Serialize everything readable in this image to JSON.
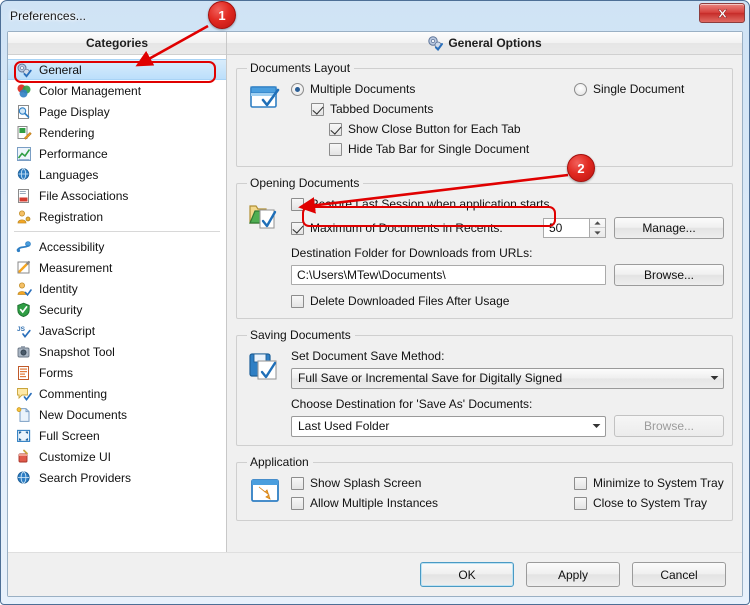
{
  "window": {
    "title": "Preferences...",
    "close_label": "Close",
    "close_icon": "window-close-icon"
  },
  "sidebar": {
    "header": "Categories",
    "selected": "General",
    "items": [
      {
        "label": "General",
        "icon": "gears-check-icon",
        "group": 1
      },
      {
        "label": "Color Management",
        "icon": "color-spheres-icon",
        "group": 1
      },
      {
        "label": "Page Display",
        "icon": "page-magnifier-icon",
        "group": 1
      },
      {
        "label": "Rendering",
        "icon": "page-pencil-icon",
        "group": 1
      },
      {
        "label": "Performance",
        "icon": "chart-graph-icon",
        "group": 1
      },
      {
        "label": "Languages",
        "icon": "globe-icon",
        "group": 1
      },
      {
        "label": "File Associations",
        "icon": "file-pdf-icon",
        "group": 1
      },
      {
        "label": "Registration",
        "icon": "user-key-icon",
        "group": 1
      },
      {
        "label": "Accessibility",
        "icon": "accessibility-icon",
        "group": 2
      },
      {
        "label": "Measurement",
        "icon": "ruler-pencil-icon",
        "group": 2
      },
      {
        "label": "Identity",
        "icon": "user-card-icon",
        "group": 2
      },
      {
        "label": "Security",
        "icon": "shield-check-icon",
        "group": 2
      },
      {
        "label": "JavaScript",
        "icon": "javascript-icon",
        "group": 2
      },
      {
        "label": "Snapshot Tool",
        "icon": "camera-icon",
        "group": 2
      },
      {
        "label": "Forms",
        "icon": "form-lines-icon",
        "group": 2
      },
      {
        "label": "Commenting",
        "icon": "comment-check-icon",
        "group": 2
      },
      {
        "label": "New Documents",
        "icon": "new-document-icon",
        "group": 2
      },
      {
        "label": "Full Screen",
        "icon": "fullscreen-icon",
        "group": 2
      },
      {
        "label": "Customize UI",
        "icon": "paint-bucket-icon",
        "group": 2
      },
      {
        "label": "Search Providers",
        "icon": "globe-search-icon",
        "group": 2
      }
    ]
  },
  "main": {
    "header": "General Options",
    "header_icon": "gears-check-icon",
    "documents_layout": {
      "legend": "Documents Layout",
      "icon": "tabbed-window-icon",
      "multiple_documents": {
        "label": "Multiple Documents",
        "checked": true
      },
      "single_document": {
        "label": "Single Document",
        "checked": false
      },
      "tabbed_documents": {
        "label": "Tabbed Documents",
        "checked": true
      },
      "show_close_button": {
        "label": "Show Close Button for Each Tab",
        "checked": true
      },
      "hide_tab_bar": {
        "label": "Hide Tab Bar for Single Document",
        "checked": false
      }
    },
    "opening_documents": {
      "legend": "Opening Documents",
      "icon": "folder-open-check-icon",
      "restore_last_session": {
        "label": "Restore Last Session when application starts",
        "checked": false
      },
      "max_recents": {
        "label": "Maximum of Documents in Recents:",
        "checked": true,
        "value": "50"
      },
      "manage_button": "Manage...",
      "destination_label": "Destination Folder for Downloads from URLs:",
      "destination_value": "C:\\Users\\MTew\\Documents\\",
      "browse_button": "Browse...",
      "delete_downloaded": {
        "label": "Delete Downloaded Files After Usage",
        "checked": false
      }
    },
    "saving_documents": {
      "legend": "Saving Documents",
      "icon": "save-disk-check-icon",
      "save_method_label": "Set Document Save Method:",
      "save_method_value": "Full Save or Incremental Save for Digitally Signed",
      "save_as_label": "Choose Destination for 'Save As' Documents:",
      "save_as_value": "Last Used Folder",
      "browse_button": "Browse..."
    },
    "application": {
      "legend": "Application",
      "icon": "app-window-icon",
      "show_splash": {
        "label": "Show Splash Screen",
        "checked": false
      },
      "allow_multiple": {
        "label": "Allow Multiple Instances",
        "checked": false
      },
      "minimize_tray": {
        "label": "Minimize to System Tray",
        "checked": false
      },
      "close_tray": {
        "label": "Close to System Tray",
        "checked": false
      }
    }
  },
  "footer": {
    "ok": "OK",
    "apply": "Apply",
    "cancel": "Cancel"
  },
  "annotations": {
    "badge1": "1",
    "badge2": "2",
    "accent_color": "#e00000"
  }
}
